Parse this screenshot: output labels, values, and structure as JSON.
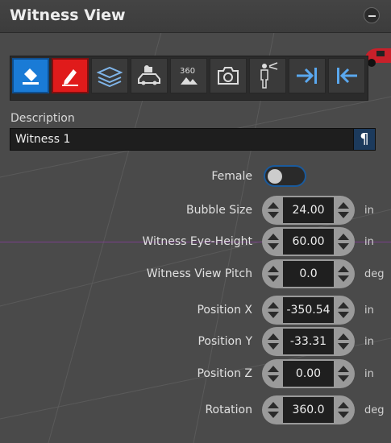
{
  "header": {
    "title": "Witness View"
  },
  "toolbar": {
    "tools": [
      {
        "name": "fill-icon"
      },
      {
        "name": "edit-pencil-icon"
      },
      {
        "name": "layers-icon"
      },
      {
        "name": "camera-car-icon"
      },
      {
        "name": "view-360-icon",
        "text": "360"
      },
      {
        "name": "camera-icon"
      },
      {
        "name": "witness-person-icon"
      },
      {
        "name": "arrow-right-to-bar-icon"
      },
      {
        "name": "arrow-left-to-bar-icon"
      }
    ]
  },
  "description": {
    "label": "Description",
    "value": "Witness 1"
  },
  "female": {
    "label": "Female",
    "on": false
  },
  "fields": [
    {
      "label": "Bubble Size",
      "value": "24.00",
      "unit": "in"
    },
    {
      "label": "Witness Eye-Height",
      "value": "60.00",
      "unit": "in"
    },
    {
      "label": "Witness View Pitch",
      "value": "0.0",
      "unit": "deg"
    },
    {
      "label": "Position X",
      "value": "-350.54",
      "unit": "in"
    },
    {
      "label": "Position Y",
      "value": "-33.31",
      "unit": "in"
    },
    {
      "label": "Position Z",
      "value": "0.00",
      "unit": "in"
    },
    {
      "label": "Rotation",
      "value": "360.0",
      "unit": "deg"
    }
  ],
  "colors": {
    "accent_blue": "#1a7bd6",
    "accent_red": "#e01b1b",
    "background": "#4a4a4a",
    "pilcrow": "#1c3a5c"
  }
}
